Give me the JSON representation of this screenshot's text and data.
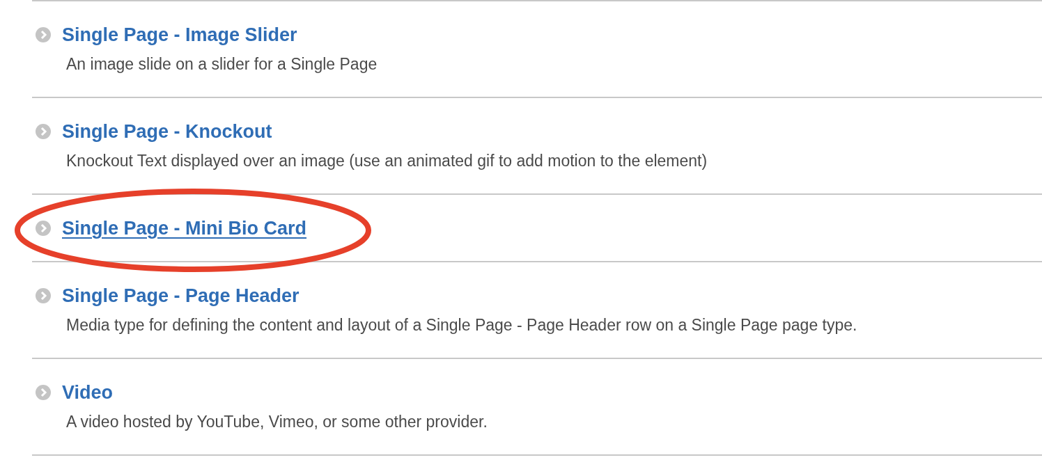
{
  "items": [
    {
      "title": "Single Page - Image Slider",
      "description": "An image slide on a slider for a Single Page",
      "hovered": false,
      "circled": false
    },
    {
      "title": "Single Page - Knockout",
      "description": "Knockout Text displayed over an image (use an animated gif to add motion to the element)",
      "hovered": false,
      "circled": false
    },
    {
      "title": "Single Page - Mini Bio Card",
      "hovered": true,
      "circled": true
    },
    {
      "title": "Single Page - Page Header",
      "description": "Media type for defining the content and layout of a Single Page - Page Header row on a Single Page page type.",
      "hovered": false,
      "circled": false
    },
    {
      "title": "Video",
      "description": "A video hosted by YouTube, Vimeo, or some other provider.",
      "hovered": false,
      "circled": false
    }
  ]
}
